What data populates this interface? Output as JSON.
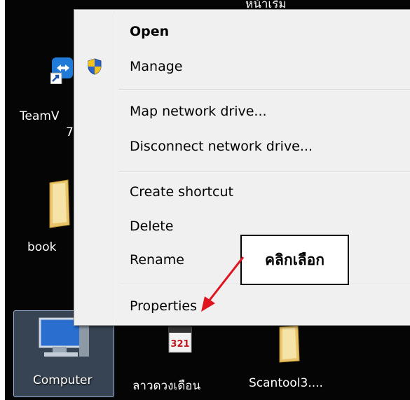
{
  "desktop": {
    "icons": [
      {
        "label_lines": [
          "TeamV",
          "7"
        ]
      },
      {
        "label": "book"
      },
      {
        "label": "Computer"
      },
      {
        "label": "ลาวดวงเดือน"
      },
      {
        "label": "Scantool3...."
      }
    ],
    "top_partial_text": "หน้าเริ่ม"
  },
  "context_menu": {
    "items": [
      {
        "label": "Open",
        "bold": true
      },
      {
        "label": "Manage",
        "icon": "uac-shield-icon"
      },
      {
        "label": "Map network drive..."
      },
      {
        "label": "Disconnect network drive..."
      },
      {
        "label": "Create shortcut"
      },
      {
        "label": "Delete"
      },
      {
        "label": "Rename"
      },
      {
        "label": "Properties"
      }
    ]
  },
  "annotation": {
    "text": "คลิกเลือก",
    "arrow_color": "#e0141e"
  }
}
